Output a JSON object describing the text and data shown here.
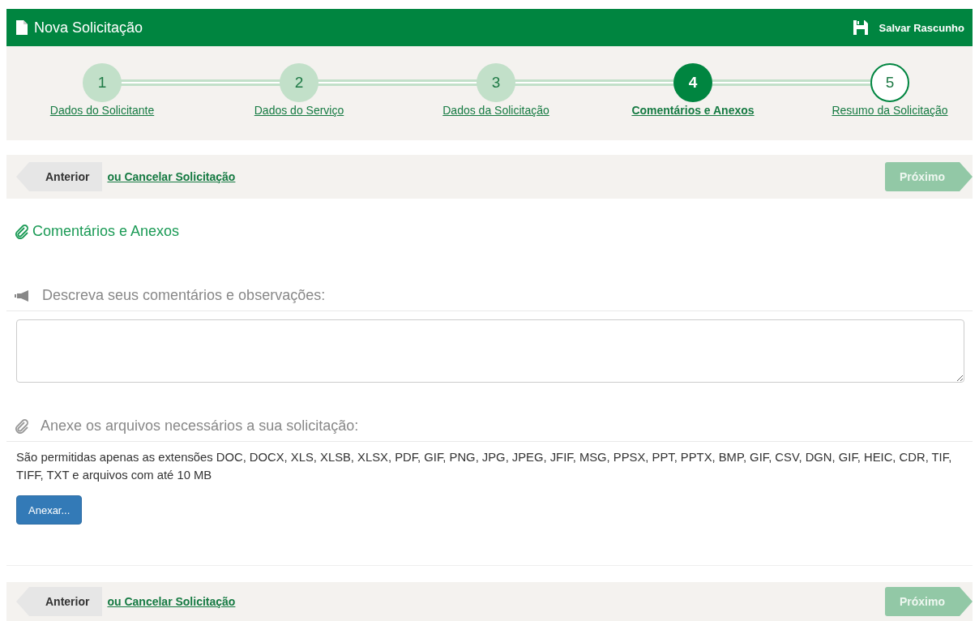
{
  "header": {
    "title": "Nova Solicitação",
    "save_label": "Salvar Rascunho"
  },
  "steps": [
    {
      "number": "1",
      "label": "Dados do Solicitante",
      "completed": true,
      "selected": false
    },
    {
      "number": "2",
      "label": "Dados do Serviço",
      "completed": true,
      "selected": false
    },
    {
      "number": "3",
      "label": "Dados da Solicitação",
      "completed": true,
      "selected": false
    },
    {
      "number": "4",
      "label": "Comentários e Anexos",
      "completed": false,
      "selected": true
    },
    {
      "number": "5",
      "label": "Resumo da Solicitação",
      "completed": false,
      "selected": false
    }
  ],
  "nav_top": {
    "previous": "Anterior",
    "cancel": "ou Cancelar Solicitação",
    "next": "Próximo",
    "next_disabled": true
  },
  "section_title": "Comentários e Anexos",
  "comments": {
    "label": "Descreva seus comentários e observações:"
  },
  "attachments": {
    "label": "Anexe os arquivos necessários a sua solicitação:",
    "note": "São permitidas apenas as extensões DOC, DOCX, XLS, XLSB, XLSX, PDF, GIF, PNG, JPG, JPEG, JFIF, MSG, PPSX, PPT, PPTX, BMP, GIF, CSV, DGN, GIF, HEIC, CDR, TIF, TIFF, TXT e arquivos com até 10 MB",
    "button": "Anexar..."
  },
  "nav_bottom": {
    "previous": "Anterior",
    "cancel": "ou Cancelar Solicitação",
    "next": "Próximo",
    "next_disabled": true
  }
}
